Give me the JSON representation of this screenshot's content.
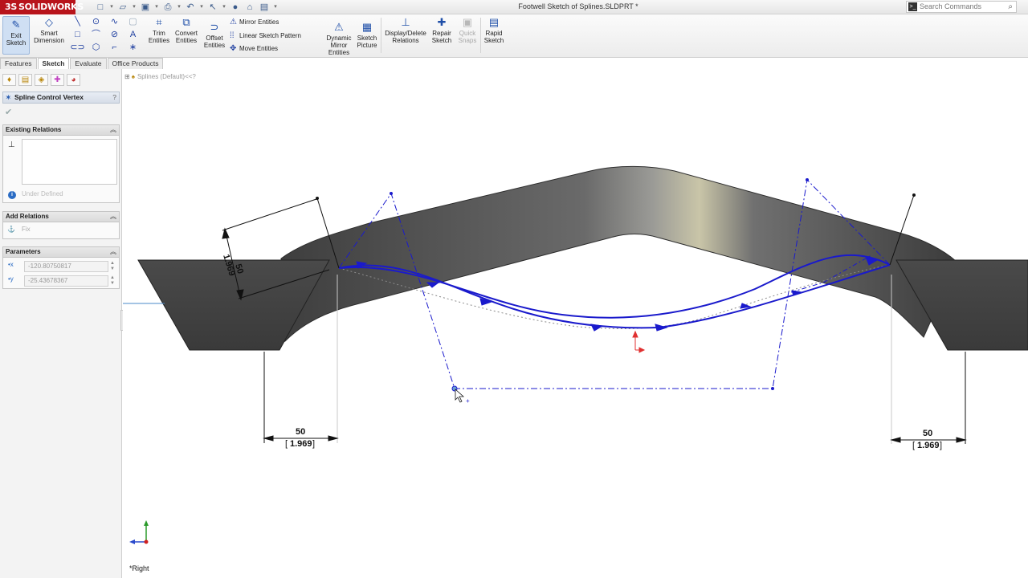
{
  "app": {
    "brand": "SOLIDWORKS",
    "brand_prefix": "3S",
    "document_title": "Footwell Sketch of Splines.SLDPRT *",
    "search_placeholder": "Search Commands",
    "accent_color": "#b8141b"
  },
  "ribbon": {
    "exit_sketch": "Exit Sketch",
    "smart_dimension": "Smart Dimension",
    "trim_entities": "Trim Entities",
    "convert_entities": "Convert Entities",
    "offset_entities": "Offset Entities",
    "mirror_entities": "Mirror Entities",
    "linear_sketch_pattern": "Linear Sketch Pattern",
    "move_entities": "Move Entities",
    "dynamic_mirror_entities": "Dynamic Mirror Entities",
    "sketch_picture": "Sketch Picture",
    "display_delete_relations": "Display/Delete Relations",
    "repair_sketch": "Repair Sketch",
    "quick_snaps": "Quick Snaps",
    "rapid_sketch": "Rapid Sketch"
  },
  "tabs": [
    {
      "label": "Features",
      "active": false
    },
    {
      "label": "Sketch",
      "active": true
    },
    {
      "label": "Evaluate",
      "active": false
    },
    {
      "label": "Office Products",
      "active": false
    }
  ],
  "property_manager": {
    "title": "Spline Control Vertex",
    "help": "?",
    "existing_relations": {
      "title": "Existing Relations",
      "status": "Under Defined"
    },
    "add_relations": {
      "title": "Add Relations",
      "fix_label": "Fix"
    },
    "parameters": {
      "title": "Parameters",
      "x_value": "-120.80750817",
      "y_value": "-25.43678367"
    }
  },
  "viewport": {
    "tree_flyout": "Splines  (Default)<<?",
    "view_name": "*Right",
    "dimensions": [
      {
        "value": "50",
        "dual": "1.969"
      },
      {
        "value": "50",
        "dual": "1.969"
      },
      {
        "value": "50",
        "dual": "1.969"
      }
    ],
    "sketch_color": "#1a1acc",
    "origin_color": "#e03030"
  }
}
